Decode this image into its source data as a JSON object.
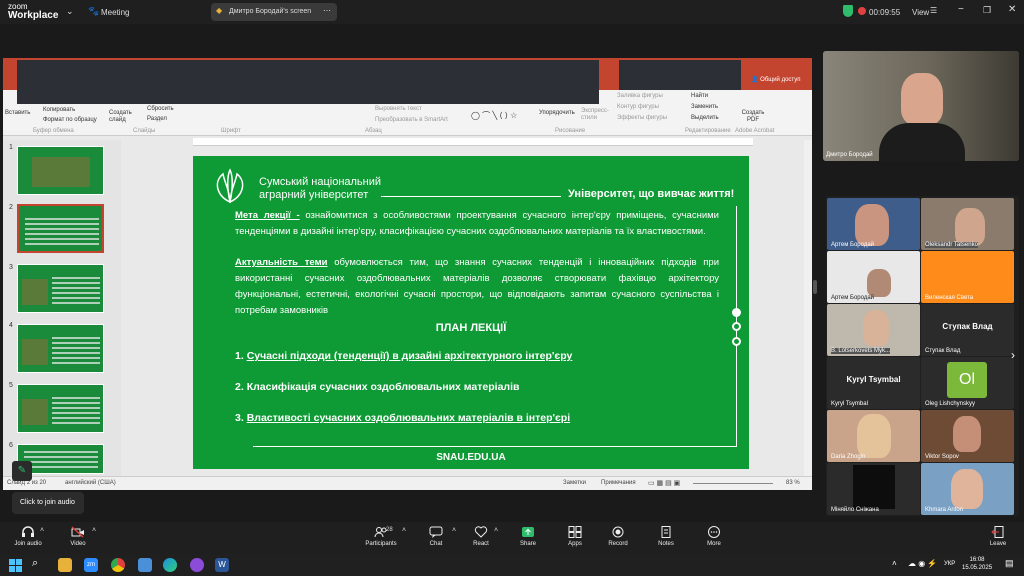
{
  "topbar": {
    "app_line1": "zoom",
    "app_line2": "Workplace",
    "meeting_label": "Meeting",
    "share_label": "Дмитро Бородай's screen",
    "timer": "00:09:55",
    "view_label": "View"
  },
  "ppt": {
    "share_access": "Общий доступ",
    "ribbon": {
      "insert": "Вставить",
      "copy": "Копировать",
      "format_brush": "Формат по образцу",
      "clipboard": "Буфер обмена",
      "create_slide": "Создать слайд",
      "reset": "Сбросить",
      "section": "Раздел",
      "slides": "Слайды",
      "font": "Шрифт",
      "paragraph": "Абзац",
      "align_text": "Выровнять текст",
      "smartart": "Преобразовать в SmartArt",
      "arrange": "Упорядочить",
      "express_styles": "Экспресс-стили",
      "shape_fill": "Заливка фигуры",
      "shape_outline": "Контур фигуры",
      "shape_effects": "Эффекты фигуры",
      "drawing": "Рисование",
      "find": "Найти",
      "replace": "Заменить",
      "select": "Выделить",
      "editing": "Редактирование",
      "create_pdf": "Создать PDF",
      "acrobat": "Adobe Acrobat"
    },
    "thumb_numbers": [
      "1",
      "2",
      "3",
      "4",
      "5",
      "6"
    ],
    "status": {
      "slide": "Слайд 2 из 20",
      "lang": "английский (США)",
      "notes": "Заметки",
      "comments": "Примечания",
      "zoom": "83 %"
    }
  },
  "slide": {
    "university_line1": "Сумський національний",
    "university_line2": "аграрний університет",
    "motto": "Університет, що вивчає життя!",
    "goal_label": "Мета лекції -",
    "goal_text": " ознайомитися з особливостями проектування сучасного інтер'єру приміщень, сучасними тенденціями в дизайні інтер'єру, класифікацією сучасних оздоблювальних матеріалів та їх властивостями.",
    "relevance_label": "Актуальність теми",
    "relevance_text": " обумовлюється тим, що знання сучасних тенденцій і інноваційних підходів при використанні сучасних оздоблювальних матеріалів дозволяє створювати фахівцю архітектору функціональні, естетичні, екологічні сучасні простори, що відповідають запитам сучасного суспільства і потребам замовників",
    "plan_title": "ПЛАН ЛЕКЦІЇ",
    "plan_items": [
      {
        "num": "1.",
        "text": "Сучасні підходи (тенденції) в дизайні архітектурного інтер'єру"
      },
      {
        "num": "2.",
        "text": "Класифікація сучасних оздоблювальних матеріалів"
      },
      {
        "num": "3.",
        "text": "Властивості сучасних оздоблювальних матеріалів в інтер'єрі"
      }
    ],
    "site": "SNAU.EDU.UA"
  },
  "speaker": {
    "name": "Дмитро Бородай"
  },
  "participants": [
    {
      "name": "Артем Бородай",
      "label": ""
    },
    {
      "name": "Oleksandr Tatsenko",
      "label": ""
    },
    {
      "name": "Артем Бородай",
      "label": ""
    },
    {
      "name": "Виленская Света",
      "label": ""
    },
    {
      "name": "B. Lotserkovets Myk...",
      "label": ""
    },
    {
      "name": "Ступак Влад",
      "label": "Ступак Влад"
    },
    {
      "name": "Kyryl Tsymbal",
      "label": "Kyryl Tsymbal"
    },
    {
      "name": "Oleg Lishchynskyy",
      "label": "Ol"
    },
    {
      "name": "Daria Zhoglo",
      "label": ""
    },
    {
      "name": "Viktor Sopov",
      "label": ""
    },
    {
      "name": "Міняйло Сніжана",
      "label": ""
    },
    {
      "name": "Khmara Anton",
      "label": ""
    }
  ],
  "tooltip": "Click to join audio",
  "toolbar": {
    "join_audio": "Join audio",
    "video": "Video",
    "participants": "Participants",
    "participants_count": "28",
    "chat": "Chat",
    "react": "React",
    "share": "Share",
    "apps": "Apps",
    "record": "Record",
    "notes": "Notes",
    "more": "More",
    "leave": "Leave"
  },
  "taskbar": {
    "lang": "УКР",
    "time": "16:08",
    "date": "15.05.2025"
  },
  "colors": {
    "slide_green": "#0e9a34",
    "ppt_red": "#c4452f",
    "share_green": "#2fbd6c"
  }
}
